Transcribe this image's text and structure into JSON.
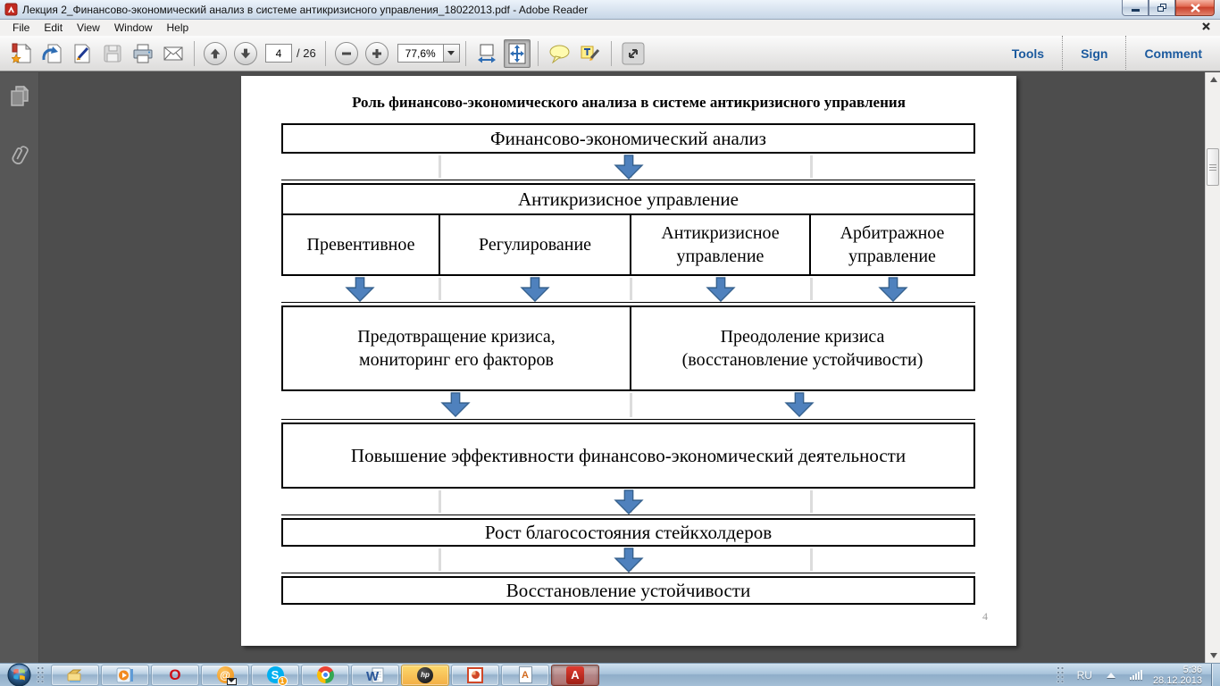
{
  "window": {
    "title": "Лекция 2_Финансово-экономический анализ в системе антикризисного управления_18022013.pdf - Adobe Reader"
  },
  "menu_bar": {
    "items": [
      "File",
      "Edit",
      "View",
      "Window",
      "Help"
    ]
  },
  "toolbar": {
    "page_current": "4",
    "page_total": "/ 26",
    "zoom_level": "77,6%",
    "actions": [
      "Tools",
      "Sign",
      "Comment"
    ],
    "icons": [
      "open-file",
      "export-pdf",
      "sign-document",
      "save",
      "print",
      "email",
      "previous-page",
      "next-page",
      "zoom-out",
      "zoom-in",
      "fit-width",
      "fit-page",
      "comment-bubble",
      "highlight-text",
      "fullscreen"
    ]
  },
  "sidebar": {
    "icons": [
      "page-thumbnails",
      "attachments-paperclip"
    ]
  },
  "document": {
    "flowchart": {
      "title": "Роль финансово-экономического анализа в системе антикризисного управления",
      "box_financial_analysis": "Финансово-экономический анализ",
      "box_anticrisis_management": "Антикризисное управление",
      "box_preventive": "Превентивное",
      "box_regulation": "Регулирование",
      "box_anticrisis_upr": "Антикризисное\nуправление",
      "box_arbitration": "Арбитражное\nуправление",
      "box_crisis_prevention": "Предотвращение кризиса,\nмониторинг его факторов",
      "box_crisis_overcoming": "Преодоление кризиса\n(восстановление устойчивости)",
      "box_efficiency": "Повышение эффективности финансово-экономический деятельности",
      "box_welfare": "Рост благосостояния стейкхолдеров",
      "box_recovery": "Восстановление устойчивости",
      "arrow_color": "#4f81bd"
    },
    "page_number": "4"
  },
  "taskbar": {
    "apps": [
      "windows-explorer",
      "windows-media-player",
      "opera",
      "mailru-agent",
      "skype",
      "chrome",
      "microsoft-word",
      "hp-assistant",
      "powerpoint",
      "text-document",
      "adobe-reader"
    ],
    "glyphs": {
      "opera": "O",
      "mail": "@",
      "skype": "S",
      "skype_badge": "1",
      "word": "W",
      "hp": "hp",
      "adoc": "A",
      "adobe": "A"
    },
    "tray": {
      "language": "RU",
      "time": "5:36",
      "date": "28.12.2013"
    }
  }
}
